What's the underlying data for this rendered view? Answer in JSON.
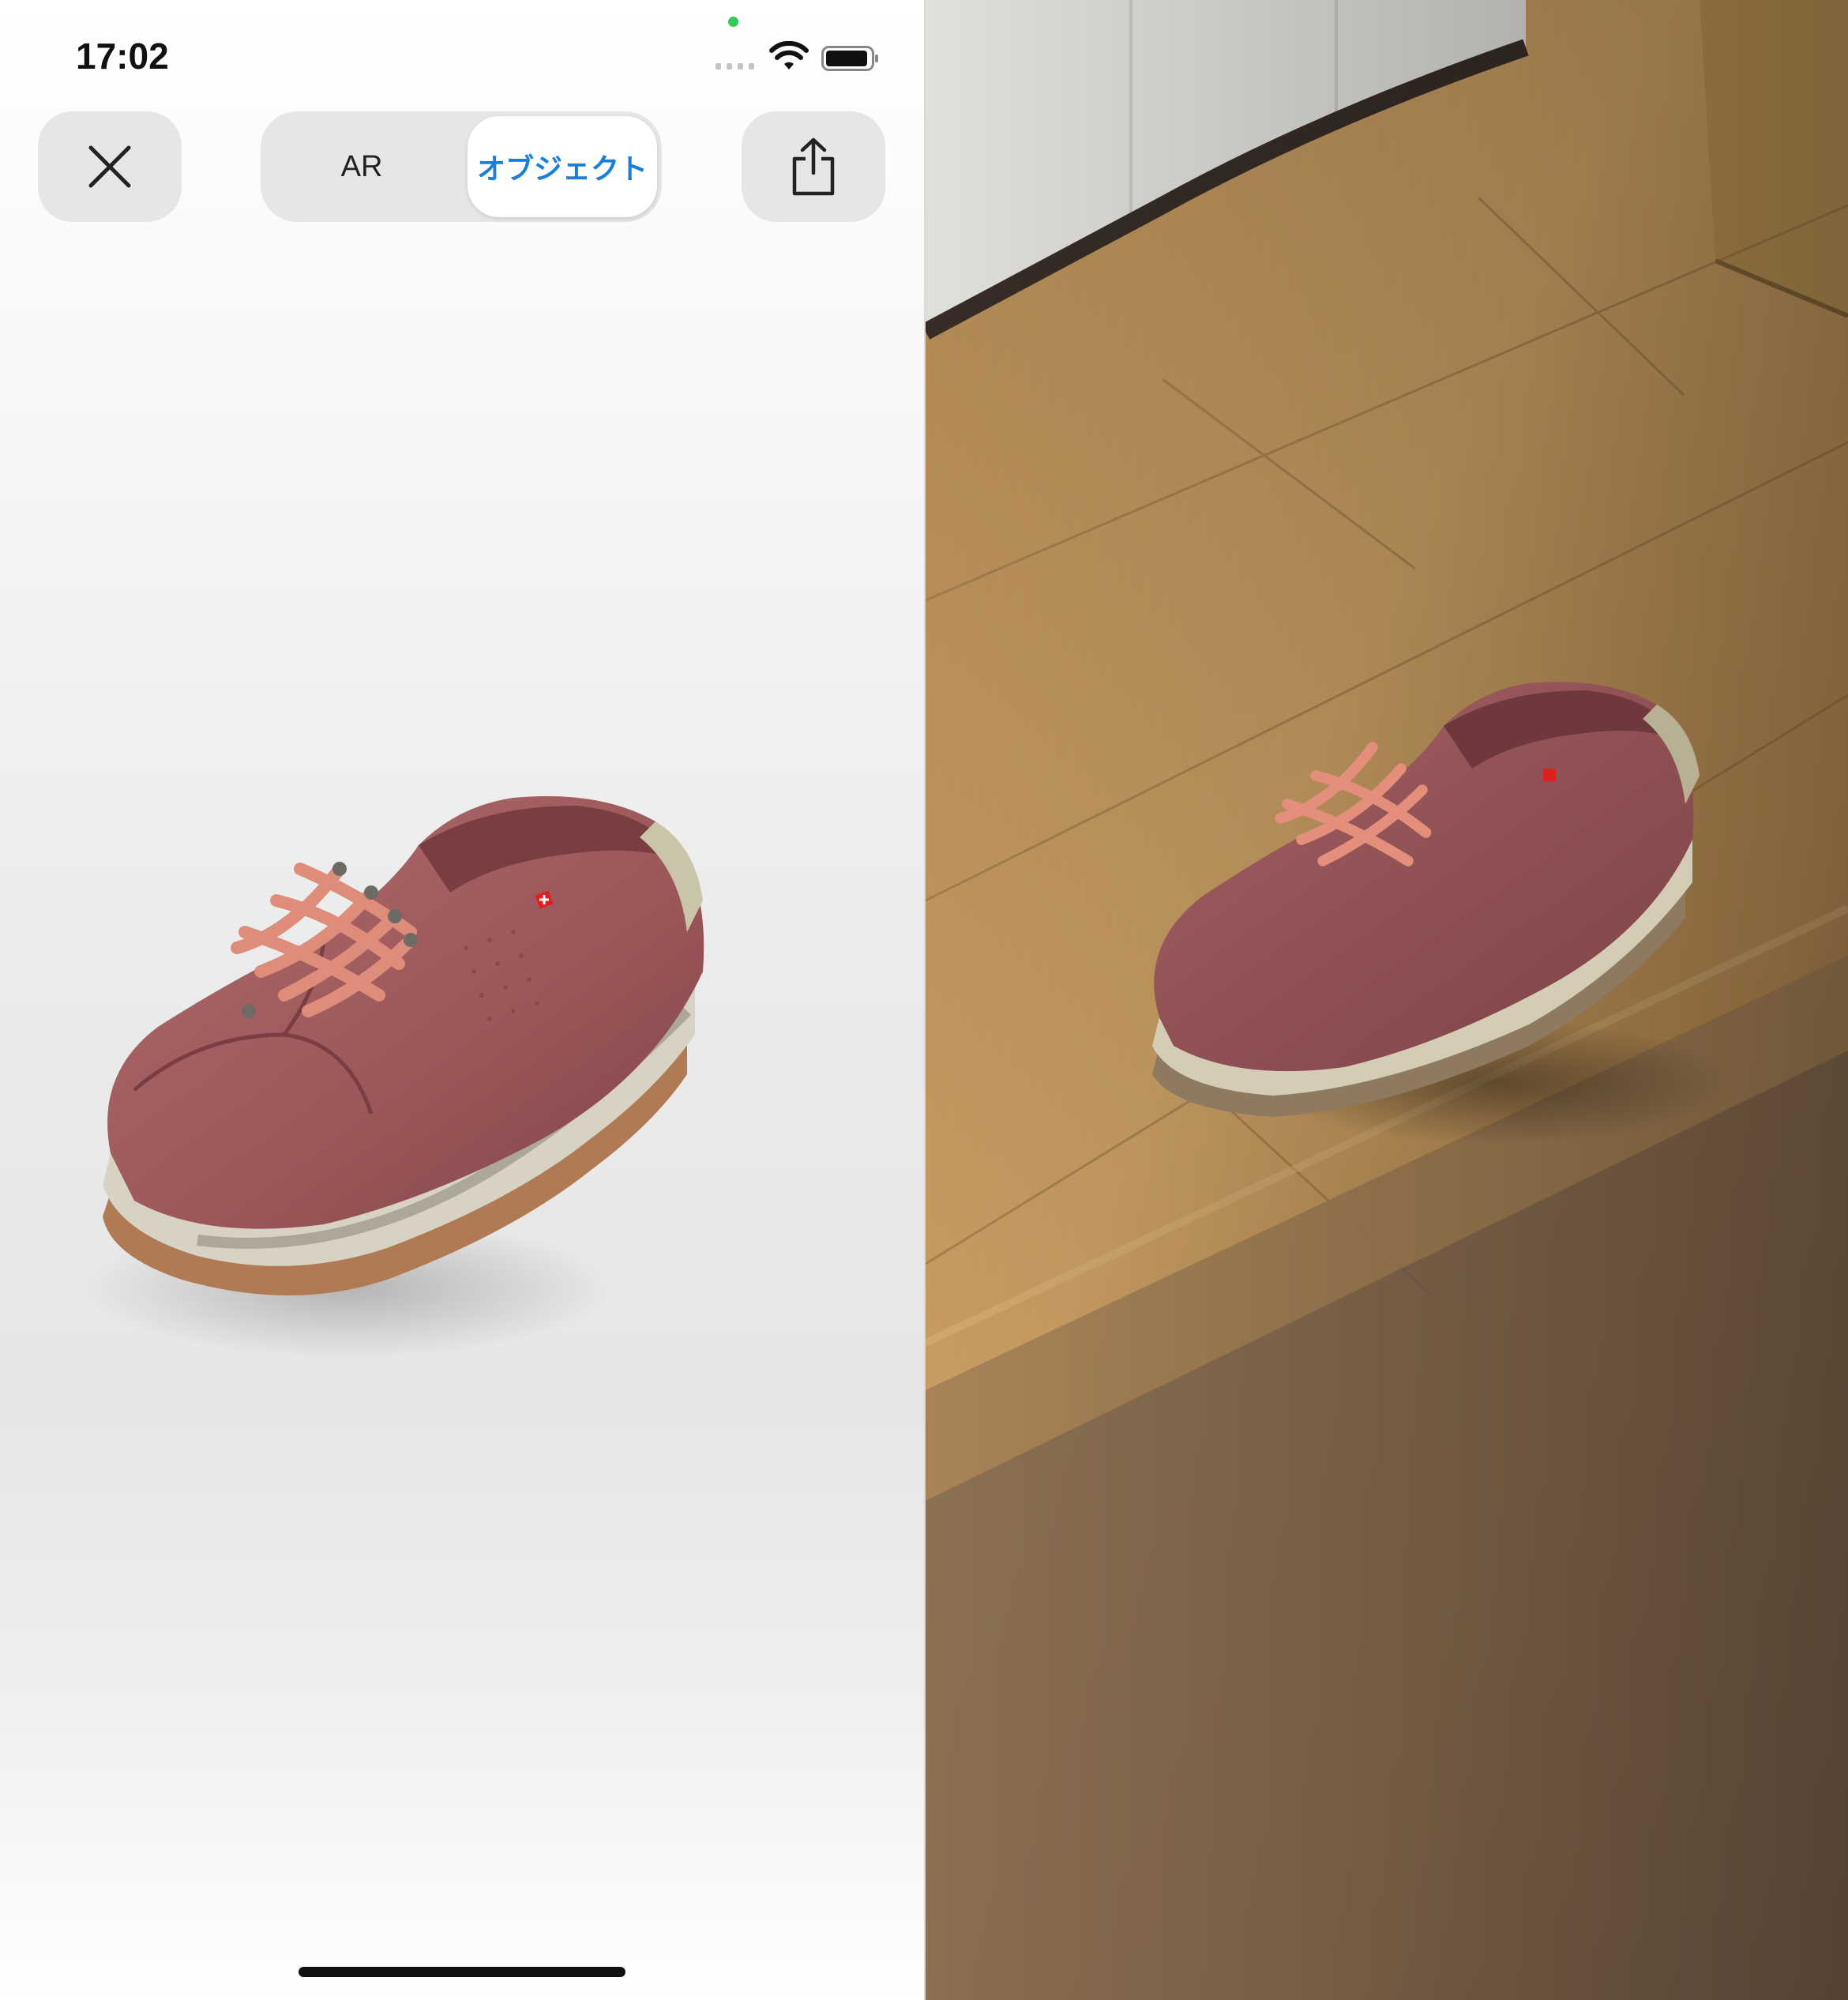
{
  "status_bar": {
    "time": "17:02"
  },
  "toolbar": {
    "close_icon": "close-icon",
    "share_icon": "share-icon",
    "segments": [
      {
        "label": "AR",
        "selected": false
      },
      {
        "label": "オブジェクト",
        "selected": true
      }
    ]
  },
  "colors": {
    "accent": "#1a7fd9",
    "button_bg": "#e6e6e6",
    "shoe_suede": "#9e5a5e",
    "laces": "#d98a78",
    "floor_wood": "#c89a5c"
  },
  "viewer": {
    "model": "sneaker-3d-model"
  },
  "ar_view": {
    "scene": "shoe-placed-on-wooden-floor"
  }
}
